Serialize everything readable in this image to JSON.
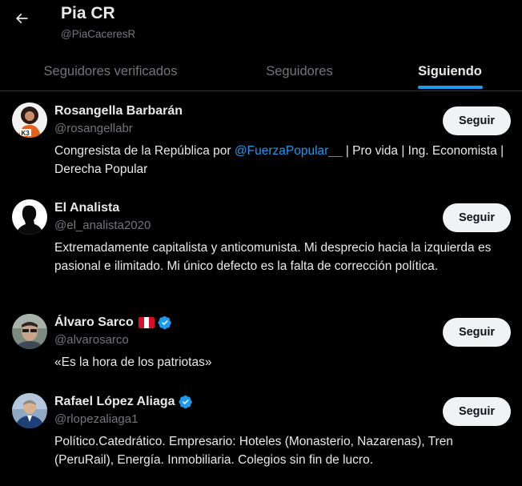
{
  "header": {
    "title": "Pia CR",
    "handle": "@PiaCaceresR"
  },
  "tabs": [
    {
      "label": "Seguidores verificados",
      "active": false
    },
    {
      "label": "Seguidores",
      "active": false
    },
    {
      "label": "Siguiendo",
      "active": true
    }
  ],
  "colors": {
    "accent": "#1d9bf0",
    "background": "#000000",
    "secondary_text": "#71767b"
  },
  "users": [
    {
      "name": "Rosangella Barbarán",
      "handle": "@rosangellabr",
      "verified": false,
      "flag": null,
      "bio_before": "Congresista de la República por ",
      "bio_mention": "@FuerzaPopular__",
      "bio_after": " | Pro vida | Ing. Economista | Derecha Popular",
      "button": "Seguir",
      "avatar_text": "K3"
    },
    {
      "name": "El Analista",
      "handle": "@el_analista2020",
      "verified": false,
      "flag": null,
      "bio": "Extremadamente capitalista y anticomunista. Mi desprecio hacia la izquierda es pasional e ilimitado. Mi único defecto es la falta de corrección política.",
      "button": "Seguir"
    },
    {
      "name": "Álvaro Sarco",
      "handle": "@alvarosarco",
      "verified": true,
      "flag": "peru-flag-icon",
      "bio": "«Es la hora de los patriotas»",
      "button": "Seguir"
    },
    {
      "name": "Rafael López Aliaga",
      "handle": "@rlopezaliaga1",
      "verified": true,
      "flag": null,
      "bio": "Político.Catedrático. Empresario: Hoteles (Monasterio, Nazarenas), Tren (PeruRail), Energía. Inmobiliaria. Colegios sin fin de lucro.",
      "button": "Seguir"
    }
  ]
}
